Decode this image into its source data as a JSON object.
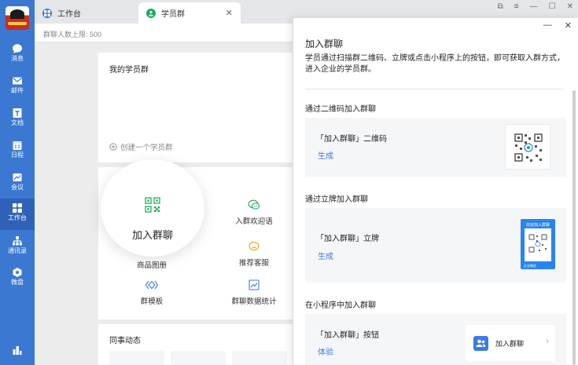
{
  "nav": {
    "items": [
      {
        "label": "消息",
        "icon": "message-icon"
      },
      {
        "label": "邮件",
        "icon": "mail-icon"
      },
      {
        "label": "文档",
        "icon": "document-icon"
      },
      {
        "label": "日程",
        "icon": "calendar-icon"
      },
      {
        "label": "会议",
        "icon": "meeting-icon"
      },
      {
        "label": "工作台",
        "icon": "workbench-icon"
      },
      {
        "label": "通讯录",
        "icon": "contacts-icon"
      },
      {
        "label": "微盘",
        "icon": "drive-icon"
      }
    ],
    "active": "工作台"
  },
  "tabs": [
    {
      "label": "工作台"
    },
    {
      "label": "学员群"
    }
  ],
  "subheader": {
    "text": "群聊人数上限: 500"
  },
  "my_groups": {
    "title": "我的学员群",
    "create_label": "创建一个学员群"
  },
  "tools": {
    "items": [
      {
        "label": "加入群聊"
      },
      {
        "label": "入群欢迎语"
      },
      {
        "label": "商品图册"
      },
      {
        "label": "推荐客服"
      },
      {
        "label": "群模板"
      },
      {
        "label": "群聊数据统计"
      }
    ]
  },
  "colleague": {
    "title": "同事动态"
  },
  "panel": {
    "title": "加入群聊",
    "description": "学员通过扫描群二维码、立牌或点击小程序上的按钮，即可获取入群方式，进入企业的学员群。",
    "sections": [
      {
        "heading": "通过二维码加入群聊",
        "item_label": "「加入群聊」二维码",
        "action": "生成"
      },
      {
        "heading": "通过立牌加入群聊",
        "item_label": "「加入群聊」立牌",
        "action": "生成"
      },
      {
        "heading": "在小程序中加入群聊",
        "item_label": "「加入群聊」按钮",
        "action": "体验"
      }
    ],
    "standee_title": "欢迎加入群聊",
    "standee_footer": "企业微信",
    "mini_button_label": "加入群聊"
  },
  "colors": {
    "sidebar": "#3a78d2",
    "accent": "#3b7be0",
    "green_icon": "#1aad5b"
  }
}
